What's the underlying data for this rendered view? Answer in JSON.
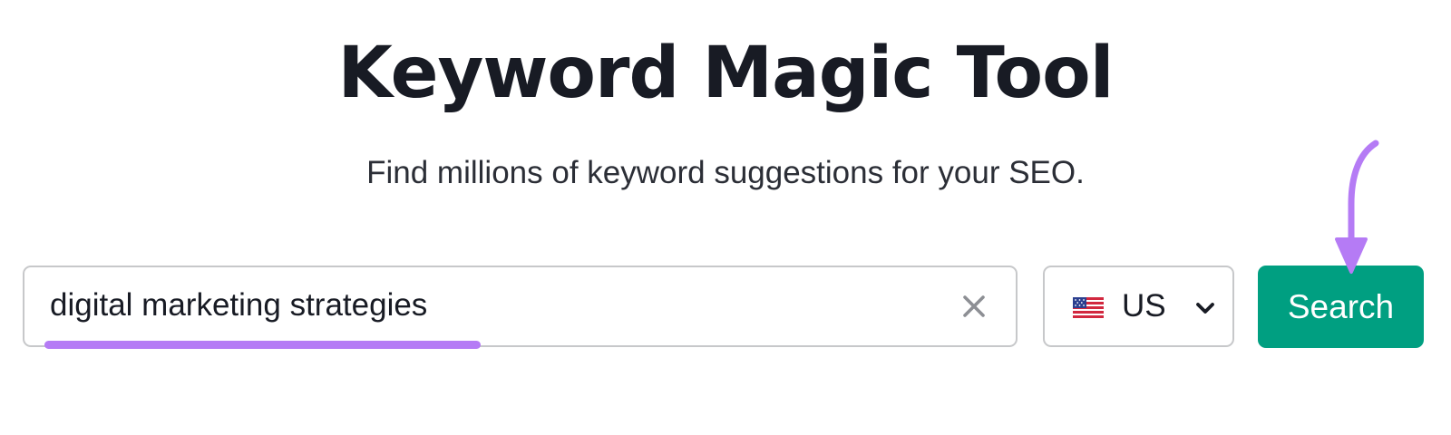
{
  "header": {
    "title": "Keyword Magic Tool",
    "subtitle": "Find millions of keyword suggestions for your SEO."
  },
  "search": {
    "value": "digital marketing strategies",
    "clear_icon": "close-icon"
  },
  "database_select": {
    "flag_icon": "us-flag-icon",
    "selected": "US",
    "dropdown_icon": "chevron-down-icon"
  },
  "search_button": {
    "label": "Search"
  },
  "annotations": {
    "accent_color": "#b57bf5",
    "arrow_icon": "arrow-down-curved-icon"
  },
  "colors": {
    "button_bg": "#009f81",
    "title": "#181b24",
    "border": "#c7c8ca"
  }
}
